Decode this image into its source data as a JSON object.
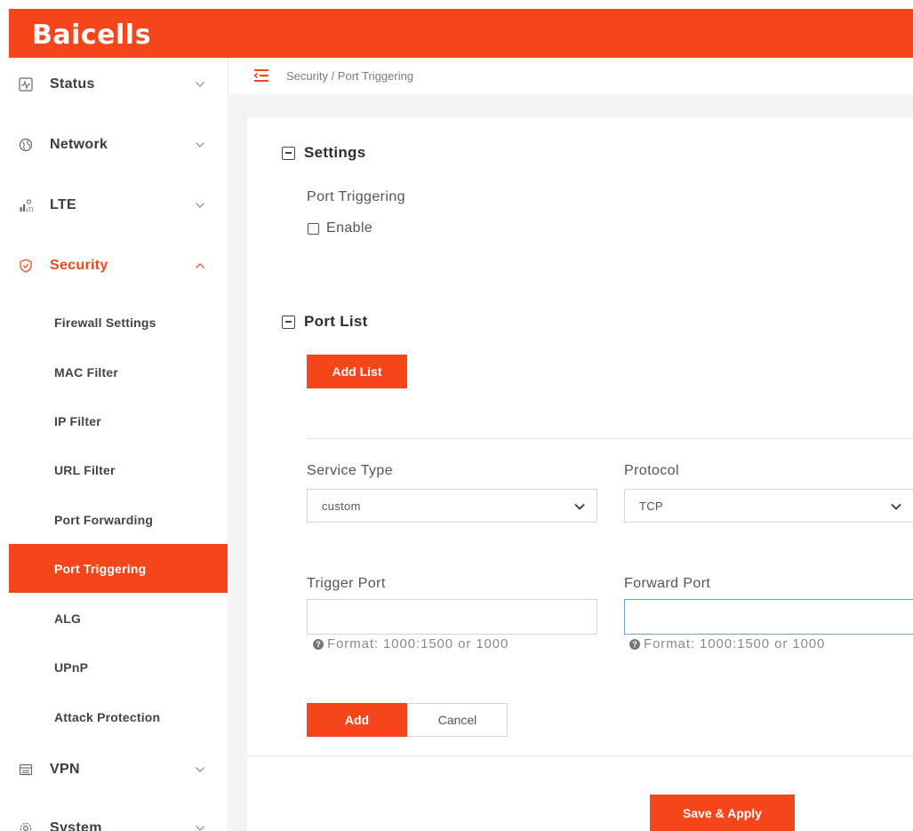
{
  "brand": {
    "logo_text": "Baicells",
    "accent_color": "#f5461b"
  },
  "breadcrumb": "Security / Port Triggering",
  "sidebar": {
    "groups": [
      {
        "label": "Status",
        "icon": "status-monitor-icon",
        "expanded": false
      },
      {
        "label": "Network",
        "icon": "globe-icon",
        "expanded": false
      },
      {
        "label": "LTE",
        "icon": "signal-bars-icon",
        "expanded": false
      },
      {
        "label": "Security",
        "icon": "shield-icon",
        "expanded": true
      },
      {
        "label": "VPN",
        "icon": "vpn-window-icon",
        "expanded": false
      },
      {
        "label": "System",
        "icon": "gear-icon",
        "expanded": false
      }
    ],
    "security_items": [
      {
        "label": "Firewall Settings"
      },
      {
        "label": "MAC Filter"
      },
      {
        "label": "IP Filter"
      },
      {
        "label": "URL Filter"
      },
      {
        "label": "Port Forwarding"
      },
      {
        "label": "Port Triggering",
        "selected": true
      },
      {
        "label": "ALG"
      },
      {
        "label": "UPnP"
      },
      {
        "label": "Attack Protection"
      }
    ]
  },
  "settings": {
    "title": "Settings",
    "field_label": "Port Triggering",
    "enable_label": "Enable",
    "enable_checked": false
  },
  "port_list": {
    "title": "Port List",
    "add_list_label": "Add List"
  },
  "form": {
    "service_type": {
      "label": "Service Type",
      "value": "custom"
    },
    "protocol": {
      "label": "Protocol",
      "value": "TCP"
    },
    "trigger_port": {
      "label": "Trigger Port",
      "value": "",
      "hint": "Format: 1000:1500 or 1000"
    },
    "forward_port": {
      "label": "Forward Port",
      "value": "",
      "hint": "Format: 1000:1500 or 1000"
    },
    "add_label": "Add",
    "cancel_label": "Cancel"
  },
  "footer": {
    "save_label": "Save & Apply"
  }
}
